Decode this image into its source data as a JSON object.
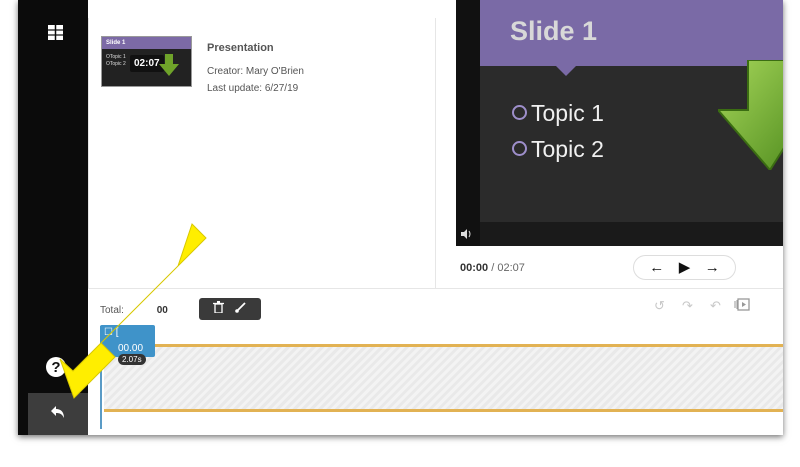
{
  "presentation": {
    "thumb_title": "Slide 1",
    "thumb_lines": "OTopic 1\nOTopic 2",
    "thumb_time": "02:07",
    "title": "Presentation",
    "creator": "Creator: Mary O'Brien",
    "last_update": "Last update: 6/27/19"
  },
  "preview": {
    "slide_title": "Slide 1",
    "bullets": [
      "Topic 1",
      "Topic 2"
    ]
  },
  "playback": {
    "current": "00:00",
    "separator": "/",
    "total": "02:07"
  },
  "timeline": {
    "total_label": "Total:",
    "total_value": "00",
    "marker_top": "☐ [",
    "marker_value": "00.00",
    "marker_chip": "2.07s"
  },
  "icons": {
    "sidebar_top": "grid-icon",
    "help": "?",
    "undo": "undo-icon",
    "volume": "volume-icon",
    "prev": "←",
    "play": "▶",
    "next": "→"
  },
  "colors": {
    "accent_purple": "#7a6aa6",
    "timeline_border": "#e2b253",
    "marker_blue": "#3f93c9",
    "annotation_arrow": "#ffee00"
  }
}
